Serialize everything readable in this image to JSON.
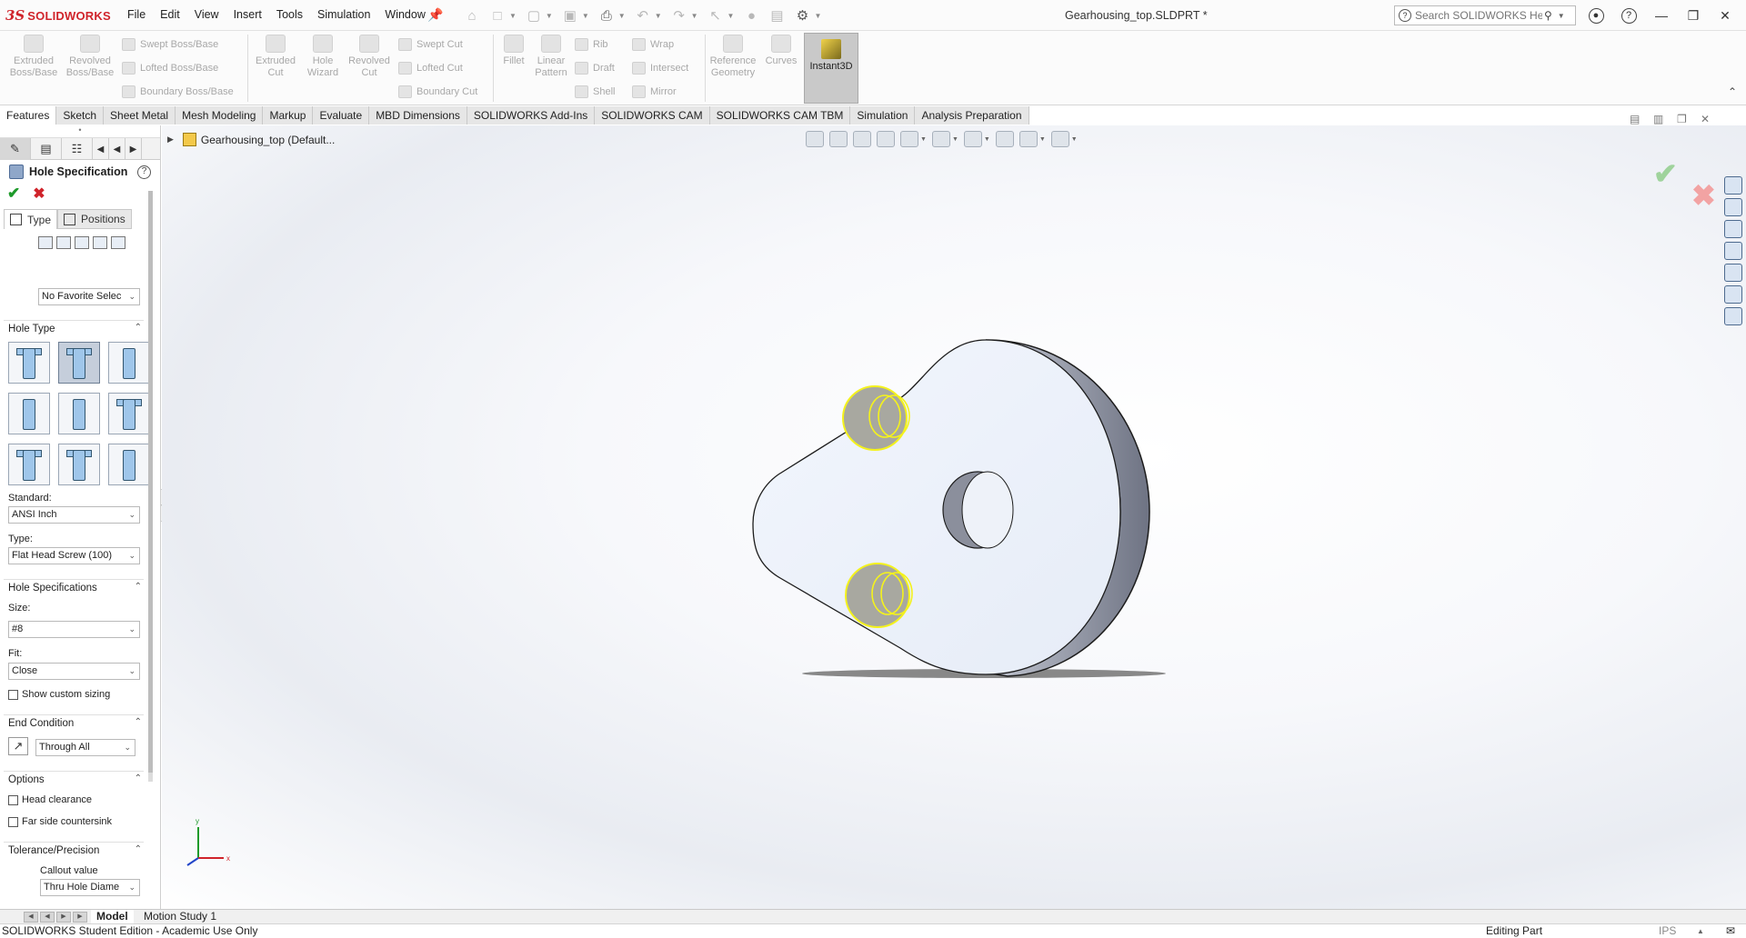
{
  "app": {
    "logo_mark": "3S",
    "logo_text": "SOLIDWORKS",
    "doc_title": "Gearhousing_top.SLDPRT *"
  },
  "menu": [
    "File",
    "Edit",
    "View",
    "Insert",
    "Tools",
    "Simulation",
    "Window"
  ],
  "search": {
    "placeholder": "Search SOLIDWORKS Help"
  },
  "ribbon": {
    "extruded_boss": [
      "Extruded",
      "Boss/Base"
    ],
    "revolved_boss": [
      "Revolved",
      "Boss/Base"
    ],
    "swept_boss": "Swept Boss/Base",
    "lofted_boss": "Lofted Boss/Base",
    "boundary_boss": "Boundary Boss/Base",
    "extruded_cut": [
      "Extruded",
      "Cut"
    ],
    "hole_wizard": [
      "Hole",
      "Wizard"
    ],
    "revolved_cut": [
      "Revolved",
      "Cut"
    ],
    "swept_cut": "Swept Cut",
    "lofted_cut": "Lofted Cut",
    "boundary_cut": "Boundary Cut",
    "fillet": "Fillet",
    "linear_pattern": [
      "Linear",
      "Pattern"
    ],
    "rib": "Rib",
    "draft": "Draft",
    "shell": "Shell",
    "wrap": "Wrap",
    "intersect": "Intersect",
    "mirror": "Mirror",
    "reference_geometry": [
      "Reference",
      "Geometry"
    ],
    "curves": "Curves",
    "instant3d": "Instant3D"
  },
  "tabs": [
    "Features",
    "Sketch",
    "Sheet Metal",
    "Mesh Modeling",
    "Markup",
    "Evaluate",
    "MBD Dimensions",
    "SOLIDWORKS Add-Ins",
    "SOLIDWORKS CAM",
    "SOLIDWORKS CAM TBM",
    "Simulation",
    "Analysis Preparation"
  ],
  "property_manager": {
    "title": "Hole Specification",
    "tab_type": "Type",
    "tab_positions": "Positions",
    "favorite": "No Favorite Selec",
    "hole_type_header": "Hole Type",
    "standard_label": "Standard:",
    "standard_value": "ANSI Inch",
    "type_label": "Type:",
    "type_value": "Flat Head Screw (100)",
    "hole_spec_header": "Hole Specifications",
    "size_label": "Size:",
    "size_value": "#8",
    "fit_label": "Fit:",
    "fit_value": "Close",
    "show_custom_sizing": "Show custom sizing",
    "end_condition_header": "End Condition",
    "end_condition_value": "Through All",
    "options_header": "Options",
    "head_clearance": "Head clearance",
    "far_side_countersink": "Far side countersink",
    "tolerance_header": "Tolerance/Precision",
    "callout_value_label": "Callout value",
    "callout_value": "Thru Hole Diame"
  },
  "tree": {
    "root": "Gearhousing_top (Default..."
  },
  "bottom_tabs": [
    "Model",
    "Motion Study 1"
  ],
  "status": {
    "left": "SOLIDWORKS Student Edition - Academic Use Only",
    "mode": "Editing Part",
    "units": "IPS"
  },
  "triad": {
    "x": "x",
    "y": "y"
  },
  "colors": {
    "brand": "#d0242b",
    "hole_highlight": "#f4f21c",
    "part_face": "#eef3fb",
    "part_edge": "#7a8090"
  }
}
